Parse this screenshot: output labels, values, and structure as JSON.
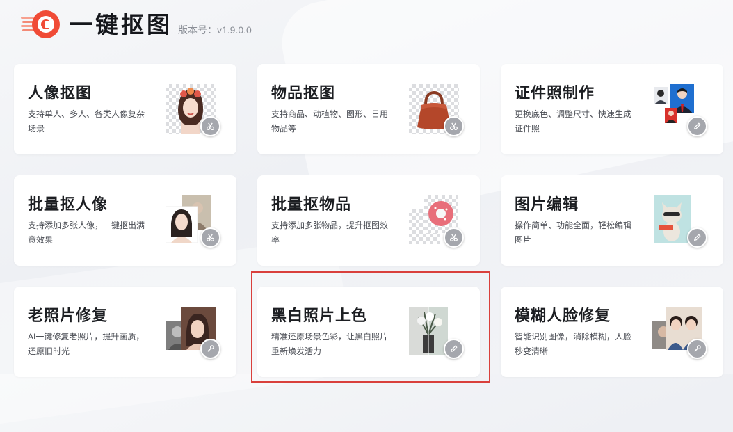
{
  "app": {
    "title": "一键抠图",
    "version": "版本号：v1.9.0.0"
  },
  "colors": {
    "brand_red": "#f04b36",
    "highlight_border": "#d9403c"
  },
  "cards": [
    {
      "title": "人像抠图",
      "desc": "支持单人、多人、各类人像复杂场景",
      "icon": "scissors-icon"
    },
    {
      "title": "物品抠图",
      "desc": "支持商品、动植物、图形、日用物品等",
      "icon": "scissors-icon"
    },
    {
      "title": "证件照制作",
      "desc": "更换底色、调整尺寸、快速生成证件照",
      "icon": "pencil-icon"
    },
    {
      "title": "批量抠人像",
      "desc": "支持添加多张人像，一键抠出满意效果",
      "icon": "scissors-icon"
    },
    {
      "title": "批量抠物品",
      "desc": "支持添加多张物品，提升抠图效率",
      "icon": "scissors-icon"
    },
    {
      "title": "图片编辑",
      "desc": "操作简单、功能全面，轻松编辑图片",
      "icon": "pencil-icon"
    },
    {
      "title": "老照片修复",
      "desc": "AI一键修复老照片，提升画质，还原旧时光",
      "icon": "wrench-icon"
    },
    {
      "title": "黑白照片上色",
      "desc": "精准还原场景色彩，让黑白照片重新焕发活力",
      "icon": "pencil-icon"
    },
    {
      "title": "模糊人脸修复",
      "desc": "智能识别图像，消除模糊，人脸秒变清晰",
      "icon": "wrench-icon"
    }
  ],
  "highlighted_card": "黑白照片上色"
}
